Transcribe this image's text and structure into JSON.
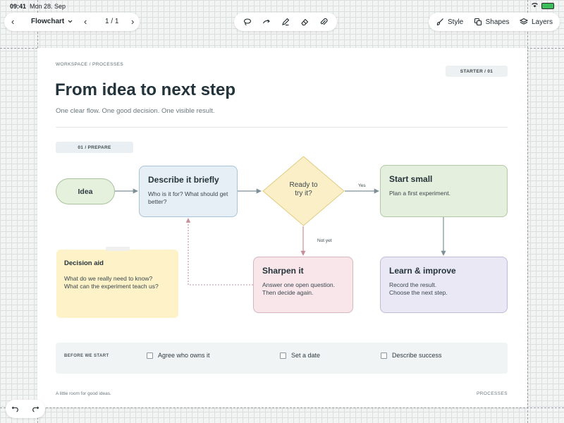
{
  "status_bar": {
    "time": "09:41",
    "date": "Mon 28. Sep"
  },
  "toolbar": {
    "back_icon": "‹",
    "document_name": "Flowchart",
    "page_indicator": "1 / 1",
    "prev_icon": "‹",
    "next_icon": "›",
    "tools": [
      "lasso-icon",
      "arrow-icon",
      "pen-icon",
      "eraser-icon",
      "attach-icon"
    ],
    "style_label": "Style",
    "shapes_label": "Shapes",
    "layers_label": "Layers"
  },
  "page": {
    "breadcrumb": "WORKSPACE  /  PROCESSES",
    "badge": "STARTER / 01",
    "title": "From idea to next step",
    "subtitle": "One clear flow. One good decision. One visible result.",
    "step_tag": "01  /  PREPARE"
  },
  "flow": {
    "idea": "Idea",
    "describe": {
      "title": "Describe it briefly",
      "body": "Who is it for? What should get better?"
    },
    "decision": {
      "line1": "Ready to",
      "line2": "try it?"
    },
    "yes_label": "Yes",
    "not_yet_label": "Not yet",
    "start": {
      "title": "Start small",
      "body": "Plan a first experiment."
    },
    "sharpen": {
      "title": "Sharpen it",
      "line1": "Answer one open question.",
      "line2": "Then decide again."
    },
    "learn": {
      "title": "Learn & improve",
      "line1": "Record the result.",
      "line2": "Choose the next step."
    },
    "decision_aid": {
      "title": "Decision aid",
      "line1": "What do we really need to know?",
      "line2": "What can the experiment teach us?"
    }
  },
  "checklist": {
    "heading": "BEFORE WE START",
    "items": [
      "Agree who owns it",
      "Set a date",
      "Describe success"
    ]
  },
  "footer": {
    "left": "A little room for good ideas.",
    "right": "PROCESSES"
  },
  "colors": {
    "accent_green": "#e5efdd",
    "accent_blue": "#e6eff6",
    "accent_yellow": "#fbefc7",
    "accent_pink": "#f8e6ea",
    "accent_purple": "#ebe8f5",
    "connector": "#7d9096"
  }
}
